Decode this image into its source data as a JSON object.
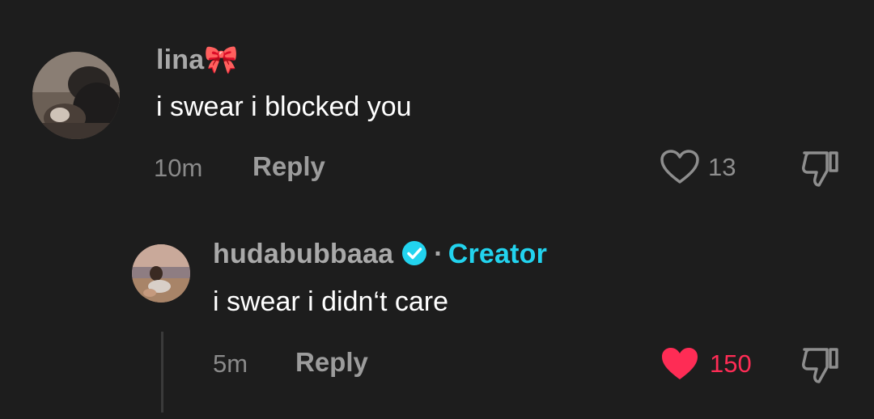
{
  "comments": [
    {
      "username": "lina",
      "username_suffix": "🎀",
      "text": "i swear i blocked you",
      "time": "10m",
      "reply_label": "Reply",
      "likes": "13",
      "liked": false,
      "like_icon": "heart-outline-icon",
      "dislike_icon": "thumbs-down-icon"
    },
    {
      "username": "hudabubbaaa",
      "verified": true,
      "separator": "·",
      "role_tag": "Creator",
      "text": "i swear i didn‘t care",
      "time": "5m",
      "reply_label": "Reply",
      "likes": "150",
      "liked": true,
      "like_icon": "heart-filled-icon",
      "dislike_icon": "thumbs-down-icon"
    }
  ],
  "colors": {
    "background": "#1d1d1d",
    "liked": "#fe2c55",
    "creator": "#22d3ee",
    "muted": "#8e8e8e"
  }
}
